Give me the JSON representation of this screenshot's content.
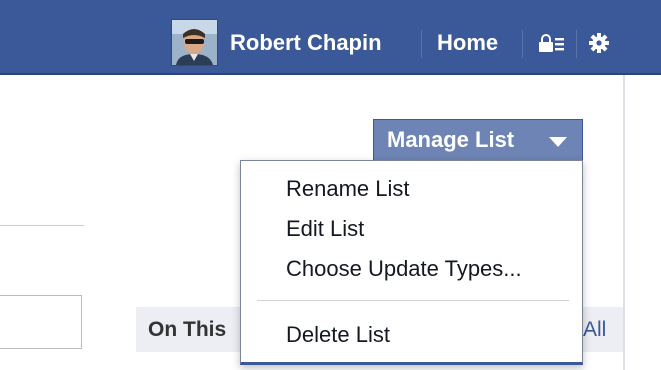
{
  "header": {
    "user_name": "Robert Chapin",
    "home_label": "Home",
    "icons": {
      "avatar": "user-avatar",
      "privacy": "privacy-shortcuts-icon",
      "settings": "gear-icon"
    },
    "colors": {
      "bar": "#3b5998",
      "bar_border": "#29447e",
      "text": "#ffffff"
    }
  },
  "list": {
    "manage_button_label": "Manage List",
    "menu_items": [
      "Rename List",
      "Edit List",
      "Choose Update Types...",
      "Delete List"
    ]
  },
  "section": {
    "title": "On This",
    "link": "All"
  }
}
